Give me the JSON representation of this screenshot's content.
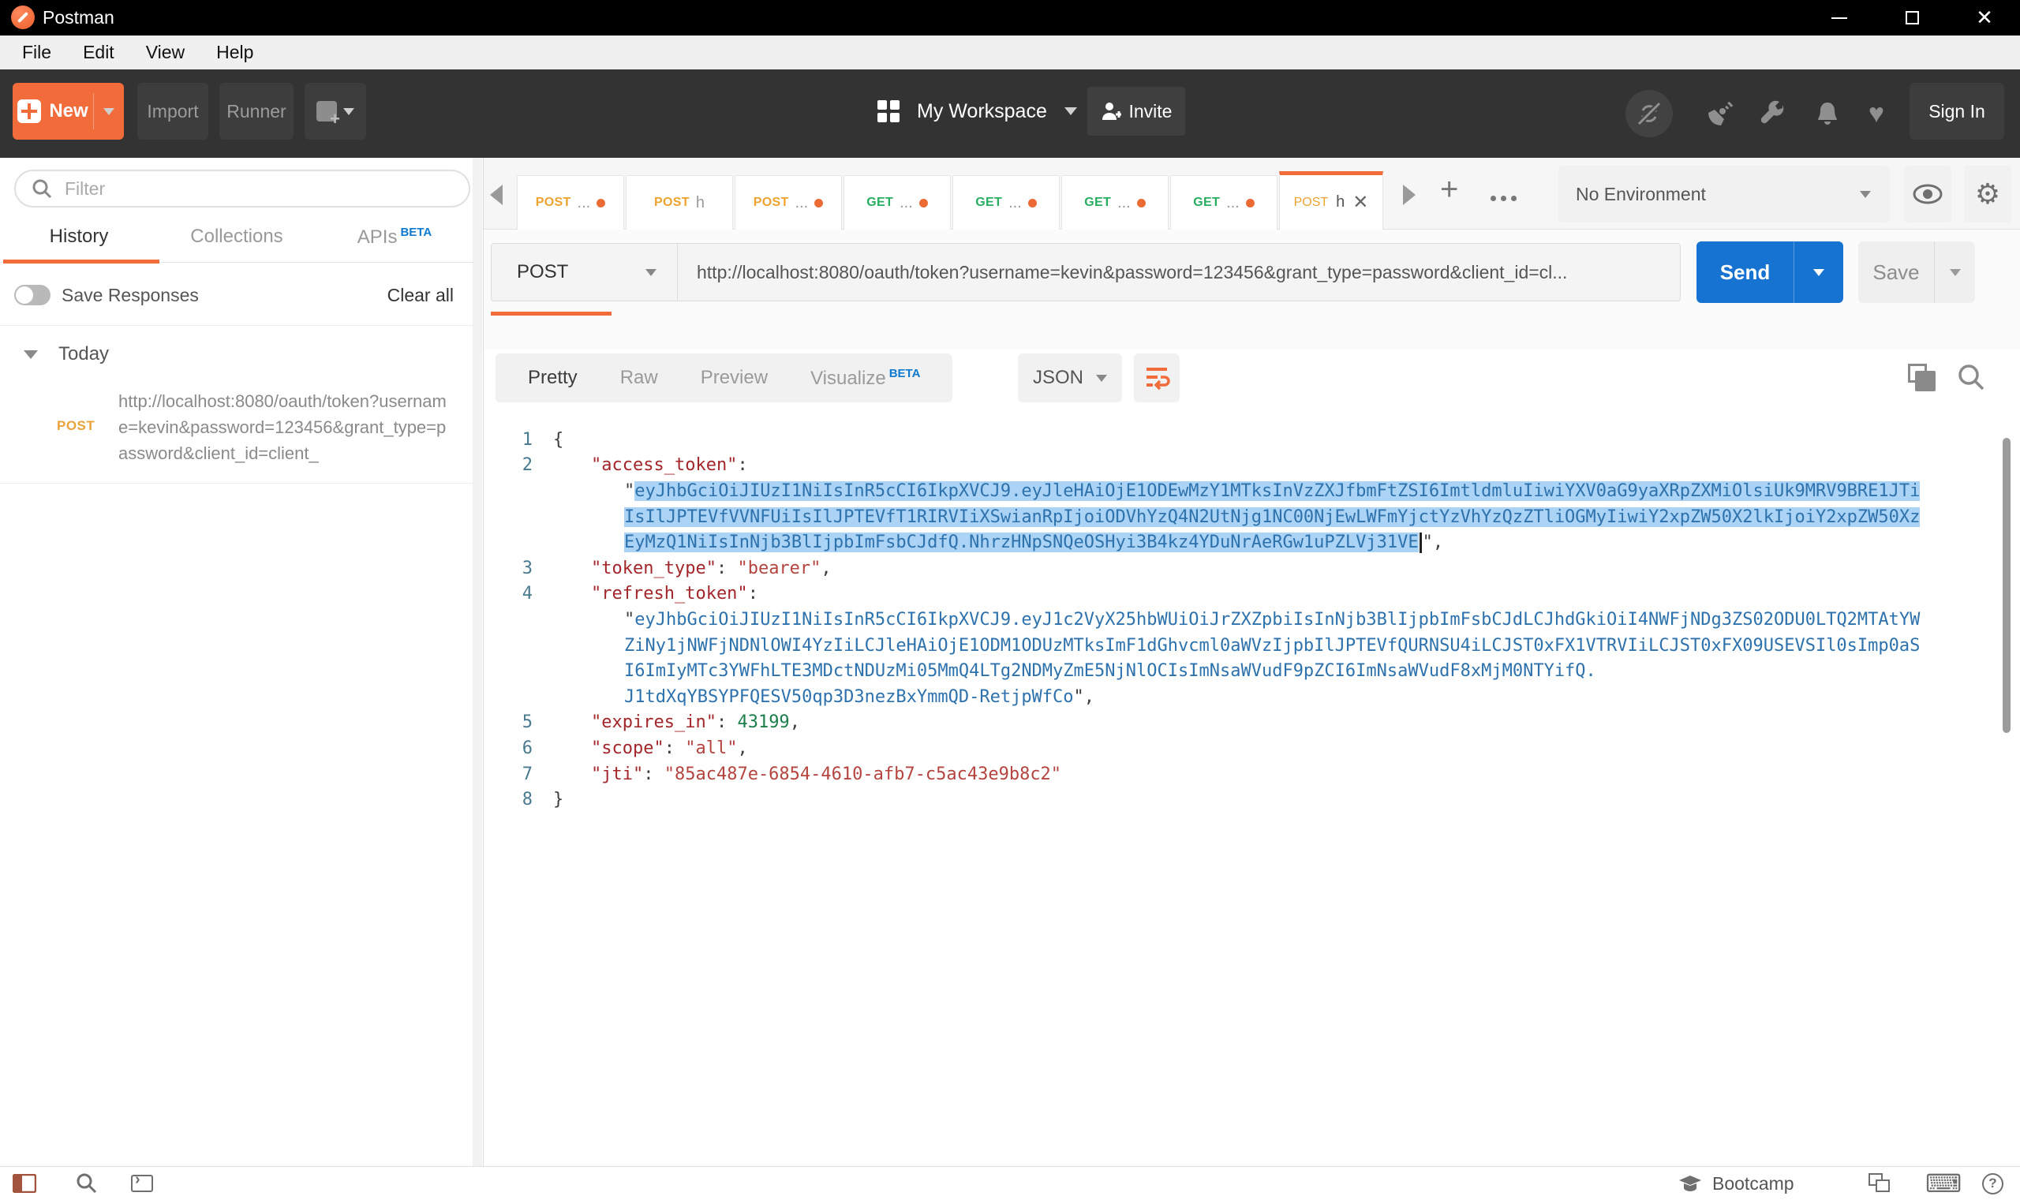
{
  "window": {
    "title": "Postman"
  },
  "menu": {
    "items": [
      "File",
      "Edit",
      "View",
      "Help"
    ]
  },
  "toolbar": {
    "new_label": "New",
    "import_label": "Import",
    "runner_label": "Runner",
    "workspace_label": "My Workspace",
    "invite_label": "Invite",
    "sign_in_label": "Sign In"
  },
  "sidebar": {
    "filter_placeholder": "Filter",
    "tabs": [
      {
        "label": "History"
      },
      {
        "label": "Collections"
      },
      {
        "label": "APIs",
        "badge": "BETA"
      }
    ],
    "save_responses_label": "Save Responses",
    "clear_all_label": "Clear all",
    "today_label": "Today",
    "history_item": {
      "method": "POST",
      "url": "http://localhost:8080/oauth/token?username=kevin&password=123456&grant_type=password&client_id=client_"
    }
  },
  "tabs": {
    "items": [
      {
        "method": "POST",
        "label": "...",
        "dot": true
      },
      {
        "method": "POST",
        "label": "h",
        "dot": false
      },
      {
        "method": "POST",
        "label": "...",
        "dot": true
      },
      {
        "method": "GET",
        "label": "...",
        "dot": true
      },
      {
        "method": "GET",
        "label": "...",
        "dot": true
      },
      {
        "method": "GET",
        "label": "...",
        "dot": true
      },
      {
        "method": "GET",
        "label": "...",
        "dot": true
      }
    ],
    "active": {
      "method": "POST",
      "label": "h",
      "close": "✕"
    }
  },
  "environment": {
    "selected": "No Environment"
  },
  "request": {
    "method": "POST",
    "url": "http://localhost:8080/oauth/token?username=kevin&password=123456&grant_type=password&client_id=cl...",
    "send_label": "Send",
    "save_label": "Save"
  },
  "response": {
    "views": [
      "Pretty",
      "Raw",
      "Preview",
      "Visualize"
    ],
    "visualize_badge": "BETA",
    "active_view": "Pretty",
    "format": "JSON"
  },
  "editor": {
    "rows": [
      {
        "n": "1",
        "ind": 0,
        "seg": [
          [
            "p",
            "{"
          ]
        ]
      },
      {
        "n": "2",
        "ind": 1,
        "seg": [
          [
            "k",
            "\"access_token\""
          ],
          [
            "p",
            ":"
          ]
        ]
      },
      {
        "n": "",
        "ind": 2,
        "seg": [
          [
            "p",
            "\""
          ],
          [
            "toksel",
            "eyJhbGciOiJIUzI1NiIsInR5cCI6IkpXVCJ9.eyJleHAiOjE1ODEwMzY1MTksInVzZXJfbmFtZSI6ImtldmluIiwiYXV0aG9yaXRpZXMiOlsiUk9MRV9BRE1JTi"
          ]
        ]
      },
      {
        "n": "",
        "ind": 2,
        "seg": [
          [
            "toksel",
            "IsIlJPTEVfVVNFUiIsIlJPTEVfT1RIRVIiXSwianRpIjoiODVhYzQ4N2UtNjg1NC00NjEwLWFmYjctYzVhYzQzZTliOGMyIiwiY2xpZW50X2lkIjoiY2xpZW50Xz"
          ]
        ]
      },
      {
        "n": "",
        "ind": 2,
        "seg": [
          [
            "toksel",
            "EyMzQ1NiIsInNjb3BlIjpbImFsbCJdfQ.NhrzHNpSNQeOSHyi3B4kz4YDuNrAeRGw1uPZLVj31VE"
          ],
          [
            "caret",
            ""
          ],
          [
            "p",
            "\","
          ]
        ]
      },
      {
        "n": "3",
        "ind": 1,
        "seg": [
          [
            "k",
            "\"token_type\""
          ],
          [
            "p",
            ": "
          ],
          [
            "s",
            "\"bearer\""
          ],
          [
            "p",
            ","
          ]
        ]
      },
      {
        "n": "4",
        "ind": 1,
        "seg": [
          [
            "k",
            "\"refresh_token\""
          ],
          [
            "p",
            ":"
          ]
        ]
      },
      {
        "n": "",
        "ind": 2,
        "seg": [
          [
            "p",
            "\""
          ],
          [
            "tok",
            "eyJhbGciOiJIUzI1NiIsInR5cCI6IkpXVCJ9.eyJ1c2VyX25hbWUiOiJrZXZpbiIsInNjb3BlIjpbImFsbCJdLCJhdGkiOiI4NWFjNDg3ZS02ODU0LTQ2MTAtYW"
          ]
        ]
      },
      {
        "n": "",
        "ind": 2,
        "seg": [
          [
            "tok",
            "ZiNy1jNWFjNDNlOWI4YzIiLCJleHAiOjE1ODM1ODUzMTksImF1dGhvcml0aWVzIjpbIlJPTEVfQURNSU4iLCJST0xFX1VTRVIiLCJST0xFX09USEVSIl0sImp0aS"
          ]
        ]
      },
      {
        "n": "",
        "ind": 2,
        "seg": [
          [
            "tok",
            "I6ImIyMTc3YWFhLTE3MDctNDUzMi05MmQ4LTg2NDMyZmE5NjNlOCIsImNsaWVudF9pZCI6ImNsaWVudF8xMjM0NTYifQ."
          ]
        ]
      },
      {
        "n": "",
        "ind": 2,
        "seg": [
          [
            "tok",
            "J1tdXqYBSYPFQESV50qp3D3nezBxYmmQD-RetjpWfCo"
          ],
          [
            "p",
            "\","
          ]
        ]
      },
      {
        "n": "5",
        "ind": 1,
        "seg": [
          [
            "k",
            "\"expires_in\""
          ],
          [
            "p",
            ": "
          ],
          [
            "n2",
            "43199"
          ],
          [
            "p",
            ","
          ]
        ]
      },
      {
        "n": "6",
        "ind": 1,
        "seg": [
          [
            "k",
            "\"scope\""
          ],
          [
            "p",
            ": "
          ],
          [
            "s",
            "\"all\""
          ],
          [
            "p",
            ","
          ]
        ]
      },
      {
        "n": "7",
        "ind": 1,
        "seg": [
          [
            "k",
            "\"jti\""
          ],
          [
            "p",
            ": "
          ],
          [
            "s",
            "\"85ac487e-6854-4610-afb7-c5ac43e9b8c2\""
          ]
        ]
      },
      {
        "n": "8",
        "ind": 0,
        "seg": [
          [
            "p",
            "}"
          ]
        ]
      }
    ]
  },
  "footer": {
    "bootcamp_label": "Bootcamp"
  },
  "colors": {
    "accent_orange": "#f26b3a",
    "method_post": "#efa32f",
    "method_get": "#27ae60",
    "send_blue": "#1673d2",
    "beta_blue": "#0f7bd0",
    "selection_blue": "#abd3f5",
    "token_blue": "#2d72ad",
    "json_key_red": "#a2262a",
    "json_number_green": "#1d7f4b"
  }
}
